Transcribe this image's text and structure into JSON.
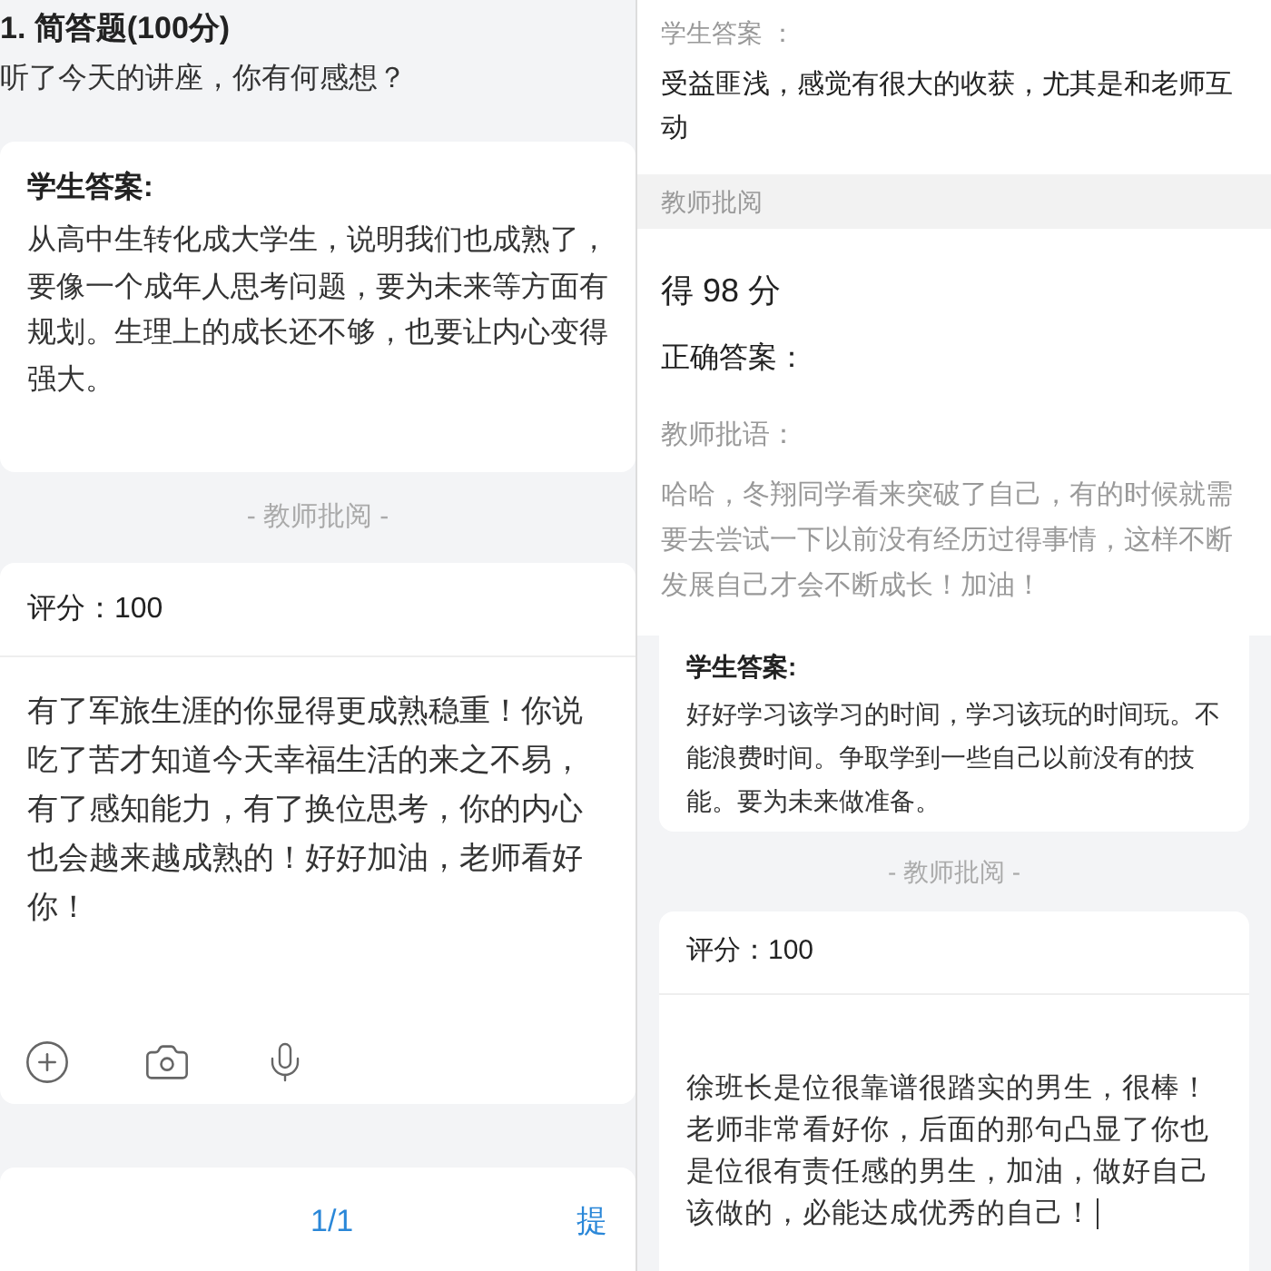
{
  "left_screen": {
    "question_title": "1. 简答题(100分)",
    "question": "听了今天的讲座，你有何感想？",
    "answer_label": "学生答案:",
    "answer": "从高中生转化成大学生，说明我们也成熟了，要像一个成年人思考问题，要为未来等方面有规划。生理上的成长还不够，也要让内心变得强大。",
    "review_label": "- 教师批阅 -",
    "score": "评分：100",
    "comment": "有了军旅生涯的你显得更成熟稳重！你说吃了苦才知道今天幸福生活的来之不易，有了感知能力，有了换位思考，你的内心也会越来越成熟的！好好加油，老师看好你！",
    "pager": "1/1",
    "submit": "提"
  },
  "right_top_screen": {
    "answer_label": "学生答案 ：",
    "answer": "受益匪浅，感觉有很大的收获，尤其是和老师互动",
    "review_band": "教师批阅",
    "score": "得 98 分",
    "correct_answer_label": "正确答案：",
    "comment_label": "教师批语：",
    "comment": "哈哈，冬翔同学看来突破了自己，有的时候就需要去尝试一下以前没有经历过得事情，这样不断发展自己才会不断成长！加油！"
  },
  "right_bottom_screen": {
    "answer_label": "学生答案:",
    "answer": "好好学习该学习的时间，学习该玩的时间玩。不能浪费时间。争取学到一些自己以前没有的技能。要为未来做准备。",
    "review_label": "- 教师批阅 -",
    "score": "评分：100",
    "comment": "徐班长是位很靠谱很踏实的男生，很棒！老师非常看好你，后面的那句凸显了你也是位很有责任感的男生，加油，做好自己该做的，必能达成优秀的自己！"
  }
}
